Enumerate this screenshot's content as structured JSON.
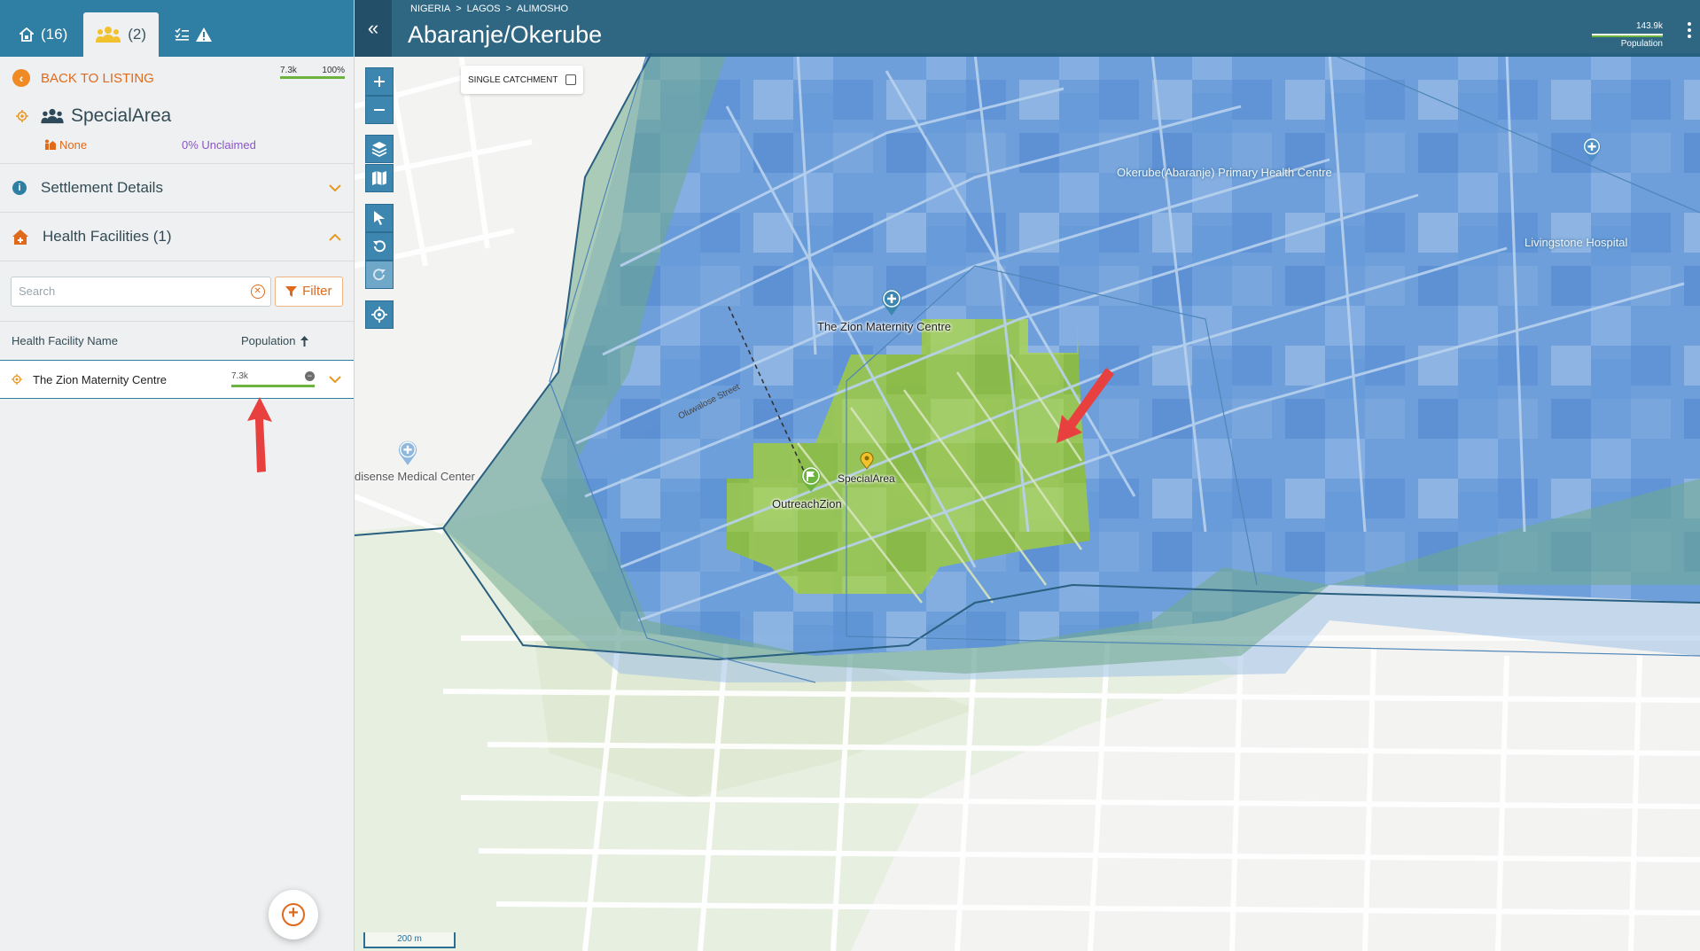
{
  "tabs": [
    {
      "count": "(16)",
      "icon": "home-icon"
    },
    {
      "count": "(2)",
      "icon": "people-icon"
    },
    {
      "icon": "checklist-warning-icon"
    }
  ],
  "back": {
    "label": "BACK TO LISTING"
  },
  "mini_population": {
    "value_label": "7.3k",
    "percent_label": "100%",
    "fill_fraction": 1.0
  },
  "area": {
    "title": "SpecialArea"
  },
  "claim": {
    "none_label": "None",
    "unclaimed_label": "0% Unclaimed"
  },
  "sections": {
    "settlement": "Settlement Details",
    "health": "Health Facilities (1)"
  },
  "search": {
    "placeholder": "Search"
  },
  "filter": {
    "label": "Filter"
  },
  "table": {
    "headers": {
      "name": "Health Facility Name",
      "population": "Population"
    },
    "rows": [
      {
        "name": "The Zion Maternity Centre",
        "population": "7.3k"
      }
    ]
  },
  "header": {
    "breadcrumb": [
      "NIGERIA",
      ">",
      "LAGOS",
      ">",
      "ALIMOSHO"
    ],
    "title": "Abaranje/Okerube",
    "population_value": "143.9k",
    "population_label": "Population"
  },
  "map": {
    "single_catchment_label": "SINGLE CATCHMENT",
    "single_catchment_checked": false,
    "scale_label": "200 m",
    "labels": {
      "zion": "The Zion Maternity Centre",
      "okerube": "Okerube(Abaranje) Primary Health Centre",
      "livingstone": "Livingstone Hospital",
      "medisense": "disense Medical Center",
      "outreach": "OutreachZion",
      "special": "SpecialArea",
      "street": "Oluwalose Street"
    }
  },
  "colors": {
    "header_bg": "#1e5a78",
    "accent_orange": "#e06a1b",
    "population_green": "#6db33f",
    "catchment_blue": "#4a86d0",
    "settlement_green": "#8dc63f",
    "unclaimed_purple": "#8a56c6"
  }
}
